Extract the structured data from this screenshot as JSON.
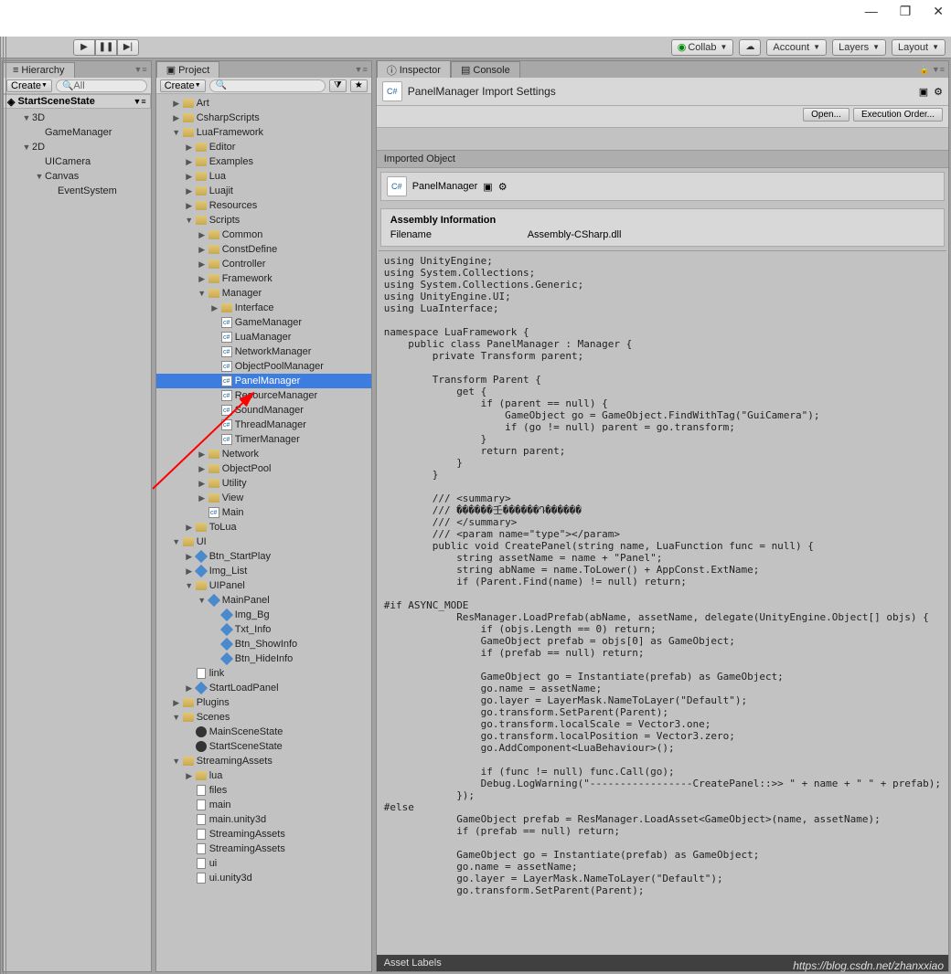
{
  "window_controls": [
    "—",
    "❐",
    "✕"
  ],
  "toolbar": {
    "play": [
      "▶",
      "❚❚",
      "▶|"
    ],
    "collab": "Collab",
    "cloud": "☁",
    "account": "Account",
    "layers": "Layers",
    "layout": "Layout"
  },
  "hierarchy": {
    "tab": "Hierarchy",
    "create": "Create",
    "search_ph": "All",
    "scene": "StartSceneState",
    "tree": [
      {
        "l": "3D",
        "d": 1,
        "f": "▼"
      },
      {
        "l": "GameManager",
        "d": 2
      },
      {
        "l": "2D",
        "d": 1,
        "f": "▼"
      },
      {
        "l": "UICamera",
        "d": 2
      },
      {
        "l": "Canvas",
        "d": 2,
        "f": "▼"
      },
      {
        "l": "EventSystem",
        "d": 3
      }
    ]
  },
  "project": {
    "tab": "Project",
    "create": "Create",
    "tree": [
      {
        "l": "Art",
        "d": 1,
        "i": "folder",
        "f": "▶"
      },
      {
        "l": "CsharpScripts",
        "d": 1,
        "i": "folder",
        "f": "▶"
      },
      {
        "l": "LuaFramework",
        "d": 1,
        "i": "folder",
        "f": "▼"
      },
      {
        "l": "Editor",
        "d": 2,
        "i": "folder",
        "f": "▶"
      },
      {
        "l": "Examples",
        "d": 2,
        "i": "folder",
        "f": "▶"
      },
      {
        "l": "Lua",
        "d": 2,
        "i": "folder",
        "f": "▶"
      },
      {
        "l": "Luajit",
        "d": 2,
        "i": "folder",
        "f": "▶"
      },
      {
        "l": "Resources",
        "d": 2,
        "i": "folder",
        "f": "▶"
      },
      {
        "l": "Scripts",
        "d": 2,
        "i": "folder",
        "f": "▼"
      },
      {
        "l": "Common",
        "d": 3,
        "i": "folder",
        "f": "▶"
      },
      {
        "l": "ConstDefine",
        "d": 3,
        "i": "folder",
        "f": "▶"
      },
      {
        "l": "Controller",
        "d": 3,
        "i": "folder",
        "f": "▶"
      },
      {
        "l": "Framework",
        "d": 3,
        "i": "folder",
        "f": "▶"
      },
      {
        "l": "Manager",
        "d": 3,
        "i": "folder",
        "f": "▼"
      },
      {
        "l": "Interface",
        "d": 4,
        "i": "folder",
        "f": "▶"
      },
      {
        "l": "GameManager",
        "d": 4,
        "i": "cs"
      },
      {
        "l": "LuaManager",
        "d": 4,
        "i": "cs"
      },
      {
        "l": "NetworkManager",
        "d": 4,
        "i": "cs"
      },
      {
        "l": "ObjectPoolManager",
        "d": 4,
        "i": "cs"
      },
      {
        "l": "PanelManager",
        "d": 4,
        "i": "cs",
        "sel": true
      },
      {
        "l": "ResourceManager",
        "d": 4,
        "i": "cs"
      },
      {
        "l": "SoundManager",
        "d": 4,
        "i": "cs"
      },
      {
        "l": "ThreadManager",
        "d": 4,
        "i": "cs"
      },
      {
        "l": "TimerManager",
        "d": 4,
        "i": "cs"
      },
      {
        "l": "Network",
        "d": 3,
        "i": "folder",
        "f": "▶"
      },
      {
        "l": "ObjectPool",
        "d": 3,
        "i": "folder",
        "f": "▶"
      },
      {
        "l": "Utility",
        "d": 3,
        "i": "folder",
        "f": "▶"
      },
      {
        "l": "View",
        "d": 3,
        "i": "folder",
        "f": "▶"
      },
      {
        "l": "Main",
        "d": 3,
        "i": "cs"
      },
      {
        "l": "ToLua",
        "d": 2,
        "i": "folder",
        "f": "▶"
      },
      {
        "l": "UI",
        "d": 1,
        "i": "folder",
        "f": "▼"
      },
      {
        "l": "Btn_StartPlay",
        "d": 2,
        "i": "prefab",
        "f": "▶"
      },
      {
        "l": "Img_List",
        "d": 2,
        "i": "prefab",
        "f": "▶"
      },
      {
        "l": "UIPanel",
        "d": 2,
        "i": "folder",
        "f": "▼"
      },
      {
        "l": "MainPanel",
        "d": 3,
        "i": "prefab",
        "f": "▼"
      },
      {
        "l": "Img_Bg",
        "d": 4,
        "i": "prefab"
      },
      {
        "l": "Txt_Info",
        "d": 4,
        "i": "prefab"
      },
      {
        "l": "Btn_ShowInfo",
        "d": 4,
        "i": "prefab"
      },
      {
        "l": "Btn_HideInfo",
        "d": 4,
        "i": "prefab"
      },
      {
        "l": "link",
        "d": 2,
        "i": "file"
      },
      {
        "l": "StartLoadPanel",
        "d": 2,
        "i": "prefab",
        "f": "▶"
      },
      {
        "l": "Plugins",
        "d": 1,
        "i": "folder",
        "f": "▶"
      },
      {
        "l": "Scenes",
        "d": 1,
        "i": "folder",
        "f": "▼"
      },
      {
        "l": "MainSceneState",
        "d": 2,
        "i": "scene"
      },
      {
        "l": "StartSceneState",
        "d": 2,
        "i": "scene"
      },
      {
        "l": "StreamingAssets",
        "d": 1,
        "i": "folder",
        "f": "▼"
      },
      {
        "l": "lua",
        "d": 2,
        "i": "folder",
        "f": "▶"
      },
      {
        "l": "files",
        "d": 2,
        "i": "file"
      },
      {
        "l": "main",
        "d": 2,
        "i": "file"
      },
      {
        "l": "main.unity3d",
        "d": 2,
        "i": "file"
      },
      {
        "l": "StreamingAssets",
        "d": 2,
        "i": "file"
      },
      {
        "l": "StreamingAssets",
        "d": 2,
        "i": "file"
      },
      {
        "l": "ui",
        "d": 2,
        "i": "file"
      },
      {
        "l": "ui.unity3d",
        "d": 2,
        "i": "file"
      }
    ]
  },
  "inspector": {
    "tab": "Inspector",
    "tab2": "Console",
    "title": "PanelManager Import Settings",
    "open": "Open...",
    "exec": "Execution Order...",
    "imported": "Imported Object",
    "objname": "PanelManager",
    "asm_title": "Assembly Information",
    "asm_label": "Filename",
    "asm_value": "Assembly-CSharp.dll",
    "code": "using UnityEngine;\nusing System.Collections;\nusing System.Collections.Generic;\nusing UnityEngine.UI;\nusing LuaInterface;\n\nnamespace LuaFramework {\n    public class PanelManager : Manager {\n        private Transform parent;\n\n        Transform Parent {\n            get {\n                if (parent == null) {\n                    GameObject go = GameObject.FindWithTag(\"GuiCamera\");\n                    if (go != null) parent = go.transform;\n                }\n                return parent;\n            }\n        }\n\n        /// <summary>\n        /// ������壬������Դ������\n        /// </summary>\n        /// <param name=\"type\"></param>\n        public void CreatePanel(string name, LuaFunction func = null) {\n            string assetName = name + \"Panel\";\n            string abName = name.ToLower() + AppConst.ExtName;\n            if (Parent.Find(name) != null) return;\n\n#if ASYNC_MODE\n            ResManager.LoadPrefab(abName, assetName, delegate(UnityEngine.Object[] objs) {\n                if (objs.Length == 0) return;\n                GameObject prefab = objs[0] as GameObject;\n                if (prefab == null) return;\n\n                GameObject go = Instantiate(prefab) as GameObject;\n                go.name = assetName;\n                go.layer = LayerMask.NameToLayer(\"Default\");\n                go.transform.SetParent(Parent);\n                go.transform.localScale = Vector3.one;\n                go.transform.localPosition = Vector3.zero;\n                go.AddComponent<LuaBehaviour>();\n\n                if (func != null) func.Call(go);\n                Debug.LogWarning(\"-----------------CreatePanel::>> \" + name + \" \" + prefab);\n            });\n#else\n            GameObject prefab = ResManager.LoadAsset<GameObject>(name, assetName);\n            if (prefab == null) return;\n\n            GameObject go = Instantiate(prefab) as GameObject;\n            go.name = assetName;\n            go.layer = LayerMask.NameToLayer(\"Default\");\n            go.transform.SetParent(Parent);",
    "asset_labels": "Asset Labels"
  },
  "watermark": "https://blog.csdn.net/zhanxxiao"
}
